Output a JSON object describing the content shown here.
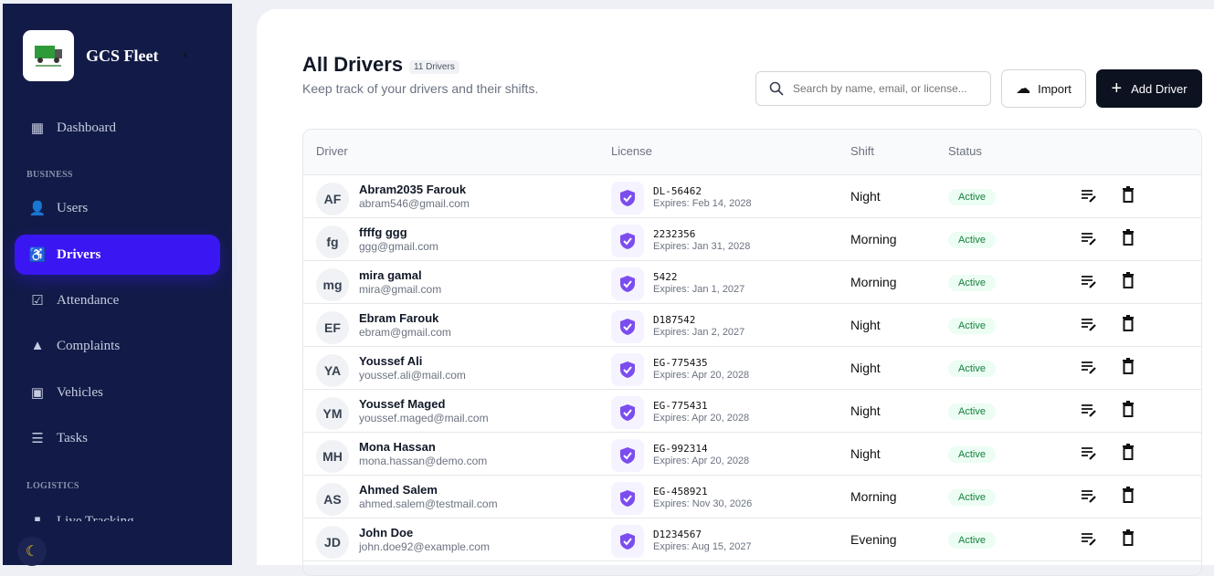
{
  "sidebar": {
    "brand": "GCS Fleet",
    "collapse": "‹",
    "sections": {
      "business": "BUSINESS",
      "logistics": "LOGISTICS"
    },
    "items": [
      {
        "label": "Dashboard"
      },
      {
        "label": "Users"
      },
      {
        "label": "Drivers"
      },
      {
        "label": "Attendance"
      },
      {
        "label": "Complaints"
      },
      {
        "label": "Vehicles"
      },
      {
        "label": "Tasks"
      },
      {
        "label": "Live Tracking"
      }
    ]
  },
  "header": {
    "title": "All Drivers",
    "count": "11 Drivers",
    "subtitle": "Keep track of your drivers and their shifts.",
    "search_placeholder": "Search by name, email, or license...",
    "import_label": "Import",
    "add_label": "Add Driver"
  },
  "table": {
    "columns": [
      "Driver",
      "License",
      "Shift",
      "Status"
    ],
    "rows": [
      {
        "initials": "AF",
        "name": "Abram2035 Farouk",
        "email": "abram546@gmail.com",
        "license": "DL-56462",
        "expires": "Expires: Feb 14, 2028",
        "shift": "Night",
        "status": "Active"
      },
      {
        "initials": "fg",
        "name": "ffffg ggg",
        "email": "ggg@gmail.com",
        "license": "2232356",
        "expires": "Expires: Jan 31, 2028",
        "shift": "Morning",
        "status": "Active"
      },
      {
        "initials": "mg",
        "name": "mira gamal",
        "email": "mira@gmail.com",
        "license": "5422",
        "expires": "Expires: Jan 1, 2027",
        "shift": "Morning",
        "status": "Active"
      },
      {
        "initials": "EF",
        "name": "Ebram Farouk",
        "email": "ebram@gmail.com",
        "license": "D187542",
        "expires": "Expires: Jan 2, 2027",
        "shift": "Night",
        "status": "Active"
      },
      {
        "initials": "YA",
        "name": "Youssef Ali",
        "email": "youssef.ali@mail.com",
        "license": "EG-775435",
        "expires": "Expires: Apr 20, 2028",
        "shift": "Night",
        "status": "Active"
      },
      {
        "initials": "YM",
        "name": "Youssef Maged",
        "email": "youssef.maged@mail.com",
        "license": "EG-775431",
        "expires": "Expires: Apr 20, 2028",
        "shift": "Night",
        "status": "Active"
      },
      {
        "initials": "MH",
        "name": "Mona Hassan",
        "email": "mona.hassan@demo.com",
        "license": "EG-992314",
        "expires": "Expires: Apr 20, 2028",
        "shift": "Night",
        "status": "Active"
      },
      {
        "initials": "AS",
        "name": "Ahmed Salem",
        "email": "ahmed.salem@testmail.com",
        "license": "EG-458921",
        "expires": "Expires: Nov 30, 2026",
        "shift": "Morning",
        "status": "Active"
      },
      {
        "initials": "JD",
        "name": "John Doe",
        "email": "john.doe92@example.com",
        "license": "D1234567",
        "expires": "Expires: Aug 15, 2027",
        "shift": "Evening",
        "status": "Active"
      }
    ]
  }
}
